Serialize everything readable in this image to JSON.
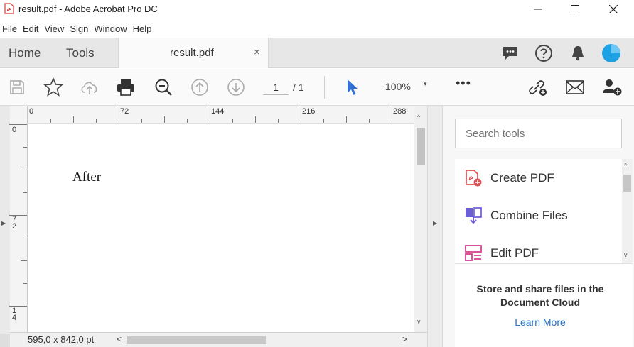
{
  "window": {
    "title": "result.pdf - Adobe Acrobat Pro DC",
    "minimize_symbol": "—",
    "maximize_symbol": "☐",
    "close_symbol": "✕"
  },
  "menu": [
    "File",
    "Edit",
    "View",
    "Sign",
    "Window",
    "Help"
  ],
  "tabs": {
    "home": "Home",
    "tools": "Tools",
    "document": "result.pdf",
    "close_symbol": "×"
  },
  "header_icons": [
    "comment-icon",
    "help-icon",
    "bell-icon",
    "account-avatar"
  ],
  "toolbar": {
    "current_page": "1",
    "total_pages": "/ 1",
    "zoom": "100%",
    "zoom_caret": "▾",
    "more": "•••",
    "icons": [
      "save-icon",
      "star-icon",
      "upload-icon",
      "print-icon",
      "zoom-out-icon",
      "page-up-icon",
      "page-down-icon",
      "select-cursor-icon",
      "share-link-icon",
      "email-icon",
      "add-user-icon"
    ]
  },
  "ruler": {
    "h_labels": [
      "0",
      "72",
      "144",
      "216",
      "288"
    ],
    "v_labels": [
      "0",
      "7\n2",
      "1\n4"
    ]
  },
  "document": {
    "text": "After",
    "page_size": "595,0 x 842,0 pt"
  },
  "scroll": {
    "up": "^",
    "down": "v",
    "left": "<",
    "right": ">"
  },
  "right_panel": {
    "search_placeholder": "Search tools",
    "tools": [
      {
        "label": "Create PDF",
        "icon": "create-pdf-icon"
      },
      {
        "label": "Combine Files",
        "icon": "combine-files-icon"
      },
      {
        "label": "Edit PDF",
        "icon": "edit-pdf-icon"
      }
    ],
    "cloud_text": "Store and share files in the Document Cloud",
    "learn_more": "Learn More"
  },
  "colors": {
    "accent_blue": "#2470c8",
    "avatar": "#1ea2e6",
    "create_pdf": "#e05050",
    "combine": "#6a5fd8",
    "edit_pdf": "#d9408f",
    "cursor": "#2f6fd6"
  }
}
